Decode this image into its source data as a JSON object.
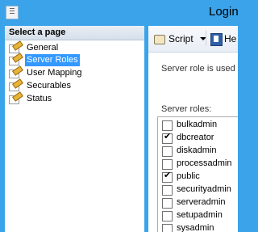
{
  "window": {
    "title": "Login"
  },
  "left_pane": {
    "header": "Select a page",
    "pages": [
      {
        "label": "General",
        "selected": false,
        "icon": "page-pen-icon"
      },
      {
        "label": "Server Roles",
        "selected": true,
        "icon": "page-pen-icon"
      },
      {
        "label": "User Mapping",
        "selected": false,
        "icon": "page-pen-icon"
      },
      {
        "label": "Securables",
        "selected": false,
        "icon": "page-pen-icon"
      },
      {
        "label": "Status",
        "selected": false,
        "icon": "page-pen-icon"
      }
    ]
  },
  "toolbar": {
    "script_label": "Script",
    "script_icon": "script-icon",
    "help_label": "He",
    "help_icon": "help-icon"
  },
  "content": {
    "description": "Server role is used to",
    "roles_label": "Server roles:",
    "roles": [
      {
        "name": "bulkadmin",
        "checked": false
      },
      {
        "name": "dbcreator",
        "checked": true
      },
      {
        "name": "diskadmin",
        "checked": false
      },
      {
        "name": "processadmin",
        "checked": false
      },
      {
        "name": "public",
        "checked": true
      },
      {
        "name": "securityadmin",
        "checked": false
      },
      {
        "name": "serveradmin",
        "checked": false
      },
      {
        "name": "setupadmin",
        "checked": false
      },
      {
        "name": "sysadmin",
        "checked": false
      }
    ]
  },
  "colors": {
    "window_frame": "#3aa3ea",
    "selection": "#3399ff"
  }
}
